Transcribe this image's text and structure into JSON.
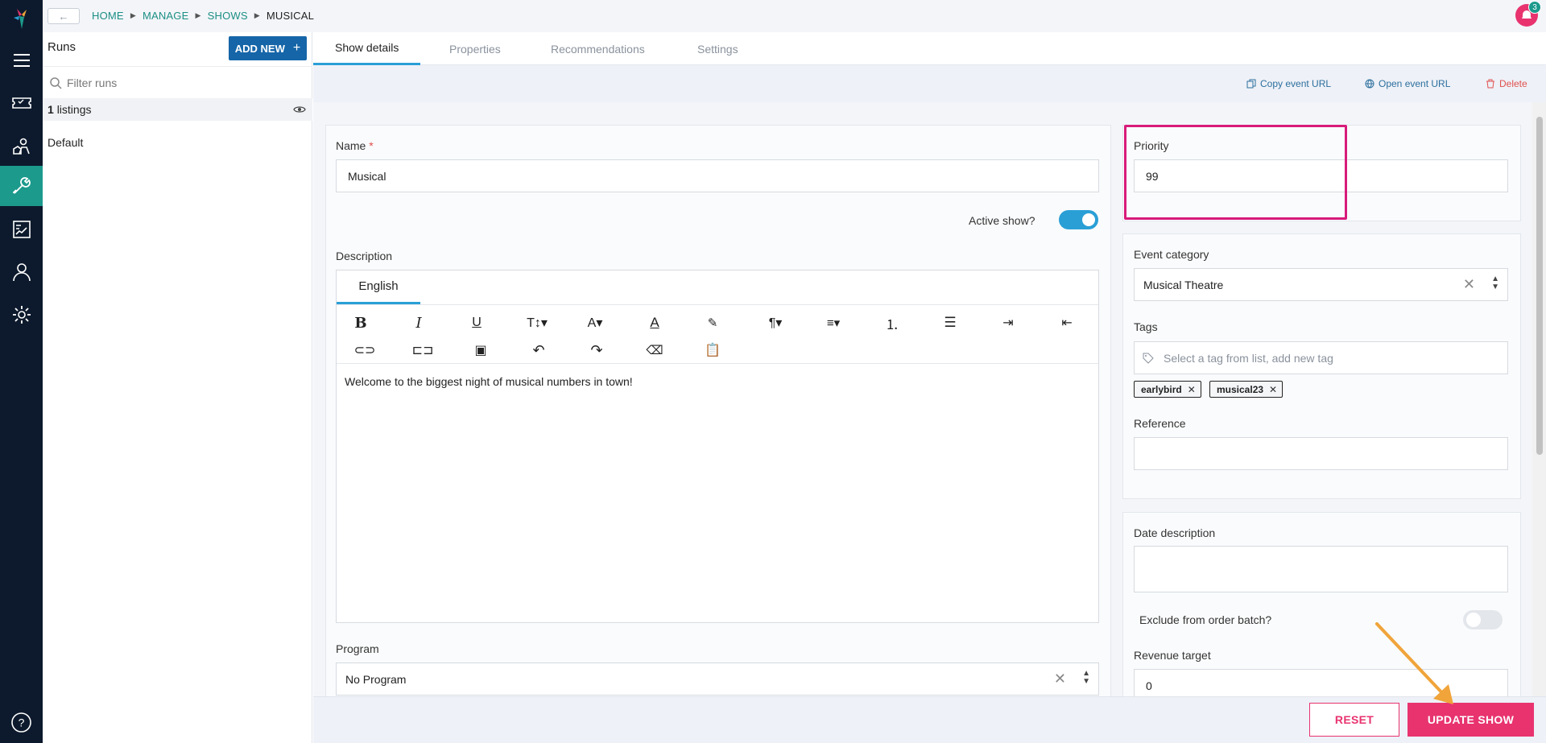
{
  "topbar": {
    "breadcrumbs": [
      "HOME",
      "MANAGE",
      "SHOWS",
      "MUSICAL"
    ],
    "notification_count": "3"
  },
  "runs": {
    "title": "Runs",
    "add_new_label": "ADD NEW",
    "filter_placeholder": "Filter runs",
    "listings_count": "1",
    "listings_label": "listings",
    "items": [
      "Default"
    ]
  },
  "tabs": [
    "Show details",
    "Properties",
    "Recommendations",
    "Settings"
  ],
  "actions": {
    "copy_url": "Copy event URL",
    "open_url": "Open event URL",
    "delete": "Delete"
  },
  "form": {
    "name_label": "Name",
    "required_mark": "*",
    "name_value": "Musical",
    "active_label": "Active show?",
    "active_on": true,
    "description_label": "Description",
    "language_tab": "English",
    "description_text": "Welcome to the biggest night of musical numbers in town!",
    "program_label": "Program",
    "program_value": "No Program",
    "priority_label": "Priority",
    "priority_value": "99",
    "event_category_label": "Event category",
    "event_category_value": "Musical Theatre",
    "tags_label": "Tags",
    "tags_placeholder": "Select a tag from list, add new tag",
    "tags": [
      "earlybird",
      "musical23"
    ],
    "reference_label": "Reference",
    "reference_value": "",
    "date_description_label": "Date description",
    "exclude_label": "Exclude from order batch?",
    "exclude_on": false,
    "revenue_label": "Revenue target",
    "revenue_value": "0"
  },
  "toolbar": {
    "row1": [
      "bold-icon",
      "italic-icon",
      "underline-icon",
      "font-size-icon",
      "font-family-icon",
      "font-color-icon",
      "highlight-icon",
      "paragraph-icon",
      "align-icon",
      "ordered-list-icon",
      "unordered-list-icon",
      "indent-icon",
      "outdent-icon"
    ],
    "row2": [
      "link-icon",
      "unlink-icon",
      "image-icon",
      "undo-icon",
      "redo-icon",
      "clear-format-icon",
      "paste-icon"
    ]
  },
  "footer": {
    "reset_label": "RESET",
    "update_label": "UPDATE SHOW"
  },
  "colors": {
    "rail": "#0d1a2d",
    "accent_teal": "#1c9a8c",
    "primary_blue": "#1565a8",
    "tab_blue": "#2a9fd6",
    "pink": "#e8336f",
    "highlight": "#d81b7a",
    "arrow": "#f0a43a"
  }
}
